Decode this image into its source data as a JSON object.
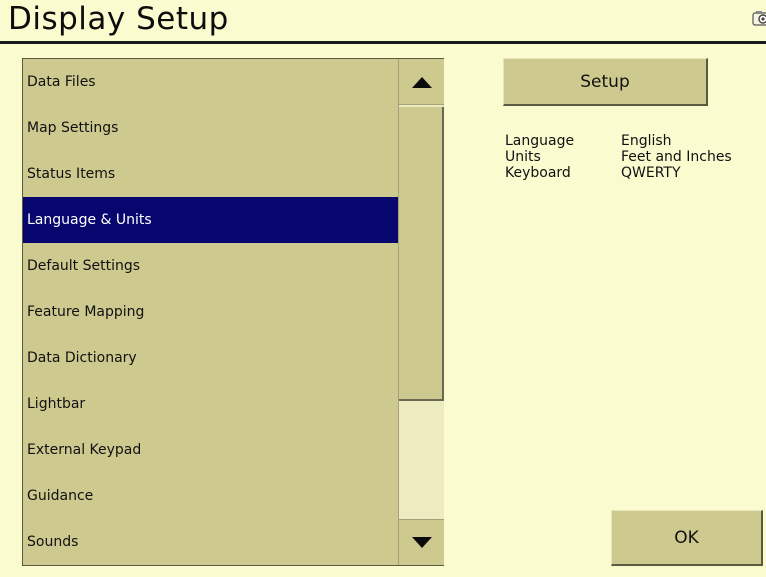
{
  "window": {
    "title": "Display Setup"
  },
  "list": {
    "items": [
      {
        "label": "Data Files",
        "selected": false
      },
      {
        "label": "Map Settings",
        "selected": false
      },
      {
        "label": "Status Items",
        "selected": false
      },
      {
        "label": "Language & Units",
        "selected": true
      },
      {
        "label": "Default Settings",
        "selected": false
      },
      {
        "label": "Feature Mapping",
        "selected": false
      },
      {
        "label": "Data Dictionary",
        "selected": false
      },
      {
        "label": "Lightbar",
        "selected": false
      },
      {
        "label": "External Keypad",
        "selected": false
      },
      {
        "label": "Guidance",
        "selected": false
      },
      {
        "label": "Sounds",
        "selected": false
      }
    ]
  },
  "buttons": {
    "setup_label": "Setup",
    "ok_label": "OK"
  },
  "info": {
    "rows": [
      {
        "label": "Language",
        "value": "English"
      },
      {
        "label": "Units",
        "value": "Feet and Inches"
      },
      {
        "label": "Keyboard",
        "value": "QWERTY"
      }
    ]
  },
  "icons": {
    "scroll_up": "triangle-up-icon",
    "scroll_down": "triangle-down-icon",
    "camera": "camera-icon"
  },
  "colors": {
    "background": "#fbfbd0",
    "panel": "#ceca8f",
    "selection": "#06066e"
  }
}
